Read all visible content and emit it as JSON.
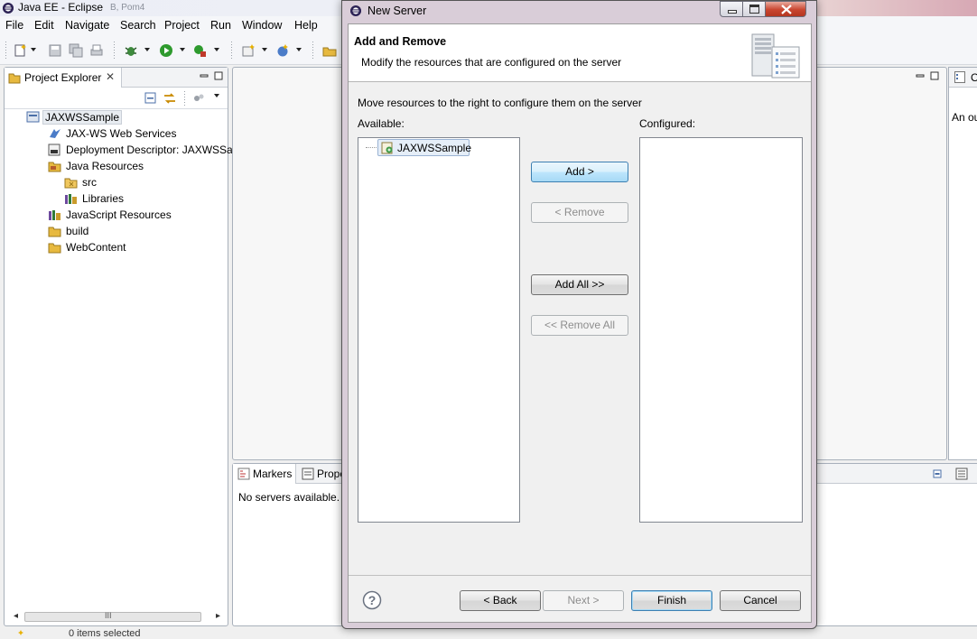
{
  "window": {
    "title": "Java EE - Eclipse",
    "ghost_tab": "B, Pom4"
  },
  "menu": [
    "File",
    "Edit",
    "Navigate",
    "Search",
    "Project",
    "Run",
    "Window",
    "Help"
  ],
  "explorer": {
    "tab_label": "Project Explorer",
    "close_glyph": "✕",
    "tree": [
      {
        "label": "JAXWSSample",
        "icon": "project-icon",
        "level": 0,
        "selected": true
      },
      {
        "label": "JAX-WS Web Services",
        "icon": "webservices-icon",
        "level": 1
      },
      {
        "label": "Deployment Descriptor: JAXWSSan",
        "icon": "descriptor-icon",
        "level": 1
      },
      {
        "label": "Java Resources",
        "icon": "java-resources-icon",
        "level": 1
      },
      {
        "label": "src",
        "icon": "package-folder-icon",
        "level": 2
      },
      {
        "label": "Libraries",
        "icon": "libraries-icon",
        "level": 2
      },
      {
        "label": "JavaScript Resources",
        "icon": "js-resources-icon",
        "level": 1
      },
      {
        "label": "build",
        "icon": "folder-icon",
        "level": 1
      },
      {
        "label": "WebContent",
        "icon": "folder-icon",
        "level": 1
      }
    ],
    "scroll_glyph": "III"
  },
  "outline": {
    "tab_label": "O",
    "text": "An ou"
  },
  "bottom_panel": {
    "tabs": [
      "Markers",
      "Prope"
    ],
    "message": "No servers available. D"
  },
  "status": {
    "text": "0 items selected"
  },
  "dialog": {
    "title": "New Server",
    "header_title": "Add and Remove",
    "header_desc": "Modify the resources that are configured on the server",
    "instruction": "Move resources to the right to configure them on the server",
    "available_label": "Available:",
    "configured_label": "Configured:",
    "available_items": [
      "JAXWSSample"
    ],
    "buttons": {
      "add": "Add >",
      "remove": "< Remove",
      "add_all": "Add All >>",
      "remove_all": "<< Remove All",
      "back": "< Back",
      "next": "Next >",
      "finish": "Finish",
      "cancel": "Cancel"
    },
    "help_glyph": "?"
  },
  "colors": {
    "accent": "#3c7fb1",
    "hover": "#bee6fd",
    "close_red": "#c9452f"
  }
}
